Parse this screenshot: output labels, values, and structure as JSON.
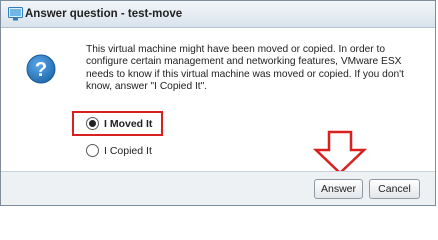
{
  "window": {
    "title": "Answer question - test-move"
  },
  "question": {
    "icon": "question-icon",
    "message": "This virtual machine might have been moved or copied. In order to configure certain management and networking features, VMware ESX needs to know if this virtual machine was moved or copied. If you don't know, answer \"I Copied It\"."
  },
  "options": [
    {
      "label": "I Moved It",
      "selected": true
    },
    {
      "label": "I Copied It",
      "selected": false
    }
  ],
  "buttons": {
    "answer_label": "Answer",
    "cancel_label": "Cancel"
  },
  "colors": {
    "highlight": "#d8201f",
    "icon_blue": "#2e7fc2"
  }
}
